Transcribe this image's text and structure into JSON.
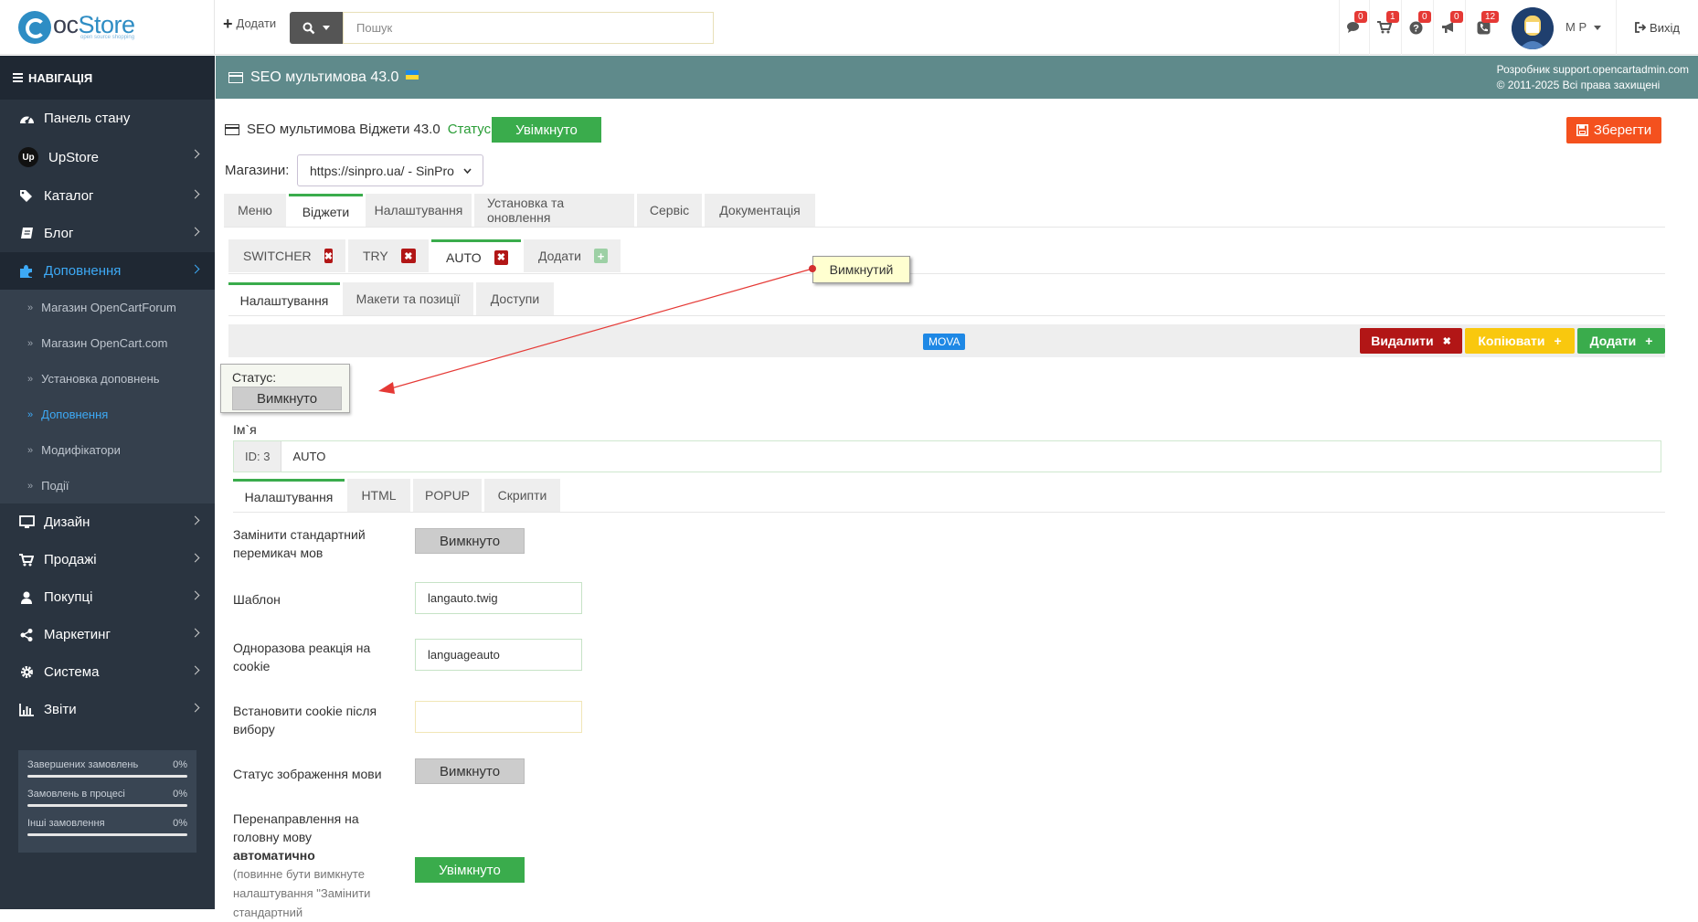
{
  "header": {
    "logo_text_a": "oc",
    "logo_text_b": "Store",
    "logo_sub": "open source shopping",
    "add_label": "Додати",
    "search_placeholder": "Пошук",
    "icons": [
      {
        "name": "comments-icon",
        "badge": "0"
      },
      {
        "name": "cart-icon",
        "badge": "1"
      },
      {
        "name": "question-icon",
        "badge": "0"
      },
      {
        "name": "bullhorn-icon",
        "badge": "0"
      },
      {
        "name": "phone-icon",
        "badge": "12"
      }
    ],
    "user_name": "M P",
    "logout_label": "Вихід"
  },
  "sidebar": {
    "nav_title": "НАВІГАЦІЯ",
    "items": [
      {
        "label": "Панель стану",
        "icon": "dashboard-icon"
      },
      {
        "label": "UpStore",
        "icon": "upstore-icon"
      },
      {
        "label": "Каталог",
        "icon": "tags-icon"
      },
      {
        "label": "Блог",
        "icon": "book-icon"
      },
      {
        "label": "Доповнення",
        "icon": "puzzle-icon"
      },
      {
        "label": "Дизайн",
        "icon": "desktop-icon"
      },
      {
        "label": "Продажі",
        "icon": "cart-icon"
      },
      {
        "label": "Покупці",
        "icon": "user-icon"
      },
      {
        "label": "Маркетинг",
        "icon": "share-icon"
      },
      {
        "label": "Система",
        "icon": "cog-icon"
      },
      {
        "label": "Звіти",
        "icon": "bar-chart-icon"
      }
    ],
    "sub_items": [
      "Магазин OpenCartForum",
      "Магазин OpenCart.com",
      "Установка доповнень",
      "Доповнення",
      "Модифікатори",
      "Події"
    ],
    "stats": [
      {
        "label": "Завершених замовлень",
        "value": "0%"
      },
      {
        "label": "Замовлень в процесі",
        "value": "0%"
      },
      {
        "label": "Інші замовлення",
        "value": "0%"
      }
    ]
  },
  "titlebar": {
    "title": "SEO мультимова 43.0",
    "dev_line1": "Розробник support.opencartadmin.com",
    "dev_line2": "© 2011-2025 Всі права захищені"
  },
  "content": {
    "module_title": "SEO мультимова Віджети 43.0",
    "status_label": "Статус",
    "status_on": "Увімкнуто",
    "save_label": "Зберегти",
    "stores_label": "Магазини:",
    "store_value": "https://sinpro.ua/ - SinPro",
    "main_tabs": [
      "Меню",
      "Віджети",
      "Налаштування",
      "Установка та оновлення",
      "Сервіс",
      "Документація"
    ],
    "widget_tabs": [
      "SWITCHER",
      "TRY",
      "AUTO"
    ],
    "widget_add": "Додати",
    "sub_tabs": [
      "Налаштування",
      "Макети та позиції",
      "Доступи"
    ],
    "mova_badge": "MOVA",
    "delete_label": "Видалити",
    "copy_label": "Копіювати",
    "add_label": "Додати",
    "status_popup_label": "Статус:",
    "status_off": "Вимкнуто",
    "tooltip": "Вимкнутий",
    "name_label": "Ім`я",
    "name_id": "ID: 3",
    "name_value": "AUTO",
    "inner_tabs": [
      "Налаштування",
      "HTML",
      "POPUP",
      "Скрипти"
    ],
    "fields": {
      "replace_switch_label": "Замінити стандартний перемикач мов",
      "replace_switch_value": "Вимкнуто",
      "template_label": "Шаблон",
      "template_value": "langauto.twig",
      "cookie_once_label": "Одноразова реакція на cookie",
      "cookie_once_value": "languageauto",
      "cookie_set_label": "Встановити cookie після вибору",
      "cookie_set_value": "",
      "lang_image_label": "Статус зображення мови",
      "lang_image_value": "Вимкнуто",
      "redirect_label_a": "Перенаправлення на головну мову",
      "redirect_label_bold": "автоматично",
      "redirect_label_note": "(повинне бути вимкнуте налаштування \"Замінити стандартний",
      "redirect_value": "Увімкнуто"
    }
  },
  "colors": {
    "accent_green": "#3aac4c",
    "sidebar_bg": "#2a3440",
    "titlebar_bg": "#5f8a8b",
    "save_orange": "#f4511e",
    "delete_red": "#b21616",
    "copy_yellow": "#f9c80e",
    "link_blue": "#3da9f5"
  }
}
